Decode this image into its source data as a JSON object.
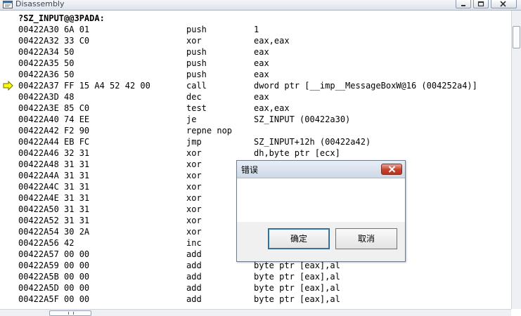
{
  "window": {
    "title": "Disassembly"
  },
  "disassembly": {
    "header": "?SZ_INPUT@@3PADA:",
    "lines": [
      {
        "addr": "00422A30 6A 01",
        "mnemonic": "push",
        "operands": "1"
      },
      {
        "addr": "00422A32 33 C0",
        "mnemonic": "xor",
        "operands": "eax,eax"
      },
      {
        "addr": "00422A34 50",
        "mnemonic": "push",
        "operands": "eax"
      },
      {
        "addr": "00422A35 50",
        "mnemonic": "push",
        "operands": "eax"
      },
      {
        "addr": "00422A36 50",
        "mnemonic": "push",
        "operands": "eax"
      },
      {
        "addr": "00422A37 FF 15 A4 52 42 00",
        "mnemonic": "call",
        "operands": "dword ptr [__imp__MessageBoxW@16 (004252a4)]",
        "current": true
      },
      {
        "addr": "00422A3D 48",
        "mnemonic": "dec",
        "operands": "eax"
      },
      {
        "addr": "00422A3E 85 C0",
        "mnemonic": "test",
        "operands": "eax,eax"
      },
      {
        "addr": "00422A40 74 EE",
        "mnemonic": "je",
        "operands": "SZ_INPUT (00422a30)"
      },
      {
        "addr": "00422A42 F2 90",
        "mnemonic": "repne nop",
        "operands": ""
      },
      {
        "addr": "00422A44 EB FC",
        "mnemonic": "jmp",
        "operands": "SZ_INPUT+12h (00422a42)"
      },
      {
        "addr": "00422A46 32 31",
        "mnemonic": "xor",
        "operands": "dh,byte ptr [ecx]"
      },
      {
        "addr": "00422A48 31 31",
        "mnemonic": "xor",
        "operands": ""
      },
      {
        "addr": "00422A4A 31 31",
        "mnemonic": "xor",
        "operands": ""
      },
      {
        "addr": "00422A4C 31 31",
        "mnemonic": "xor",
        "operands": ""
      },
      {
        "addr": "00422A4E 31 31",
        "mnemonic": "xor",
        "operands": ""
      },
      {
        "addr": "00422A50 31 31",
        "mnemonic": "xor",
        "operands": ""
      },
      {
        "addr": "00422A52 31 31",
        "mnemonic": "xor",
        "operands": ""
      },
      {
        "addr": "00422A54 30 2A",
        "mnemonic": "xor",
        "operands": ""
      },
      {
        "addr": "00422A56 42",
        "mnemonic": "inc",
        "operands": ""
      },
      {
        "addr": "00422A57 00 00",
        "mnemonic": "add",
        "operands": ""
      },
      {
        "addr": "00422A59 00 00",
        "mnemonic": "add",
        "operands": "byte ptr [eax],al"
      },
      {
        "addr": "00422A5B 00 00",
        "mnemonic": "add",
        "operands": "byte ptr [eax],al"
      },
      {
        "addr": "00422A5D 00 00",
        "mnemonic": "add",
        "operands": "byte ptr [eax],al"
      },
      {
        "addr": "00422A5F 00 00",
        "mnemonic": "add",
        "operands": "byte ptr [eax],al"
      }
    ]
  },
  "dialog": {
    "title": "错误",
    "ok_label": "确定",
    "cancel_label": "取消"
  },
  "colors": {
    "ip_arrow_fill": "#ffff00",
    "ip_arrow_stroke": "#6b6b00",
    "close_button": "#c7402b"
  },
  "icons": {
    "window": "window-icon",
    "ip_marker": "current-instruction-arrow-icon",
    "close": "close-icon"
  }
}
